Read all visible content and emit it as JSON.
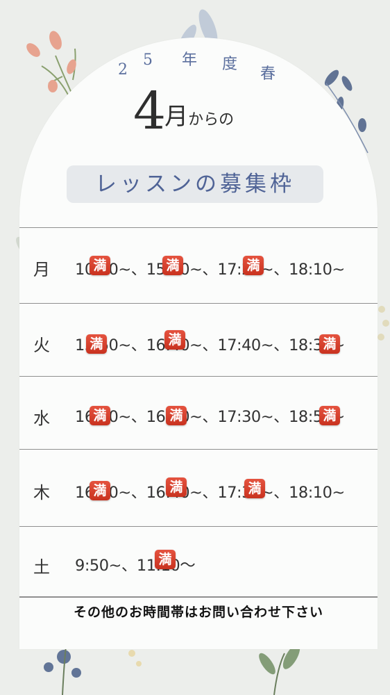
{
  "season_label": [
    "2",
    "5",
    "年",
    "度",
    "春"
  ],
  "headline": {
    "number": "4",
    "month": "月",
    "rest": "からの"
  },
  "title": "レッスンの募集枠",
  "full_badge": "満",
  "schedule": [
    {
      "day": "月",
      "times": "10:10~、15:40~、17:20~、18:10~"
    },
    {
      "day": "火",
      "times": "15:50~、16:40~、17:40~、18:30~"
    },
    {
      "day": "水",
      "times": "16:40~、16:50~、17:30~、18:50~"
    },
    {
      "day": "木",
      "times": "16:50~、16:40~、17:30~、18:10~"
    },
    {
      "day": "土",
      "times": "9:50~、11:10〜"
    }
  ],
  "note": "その他のお時間帯はお問い合わせ下さい"
}
